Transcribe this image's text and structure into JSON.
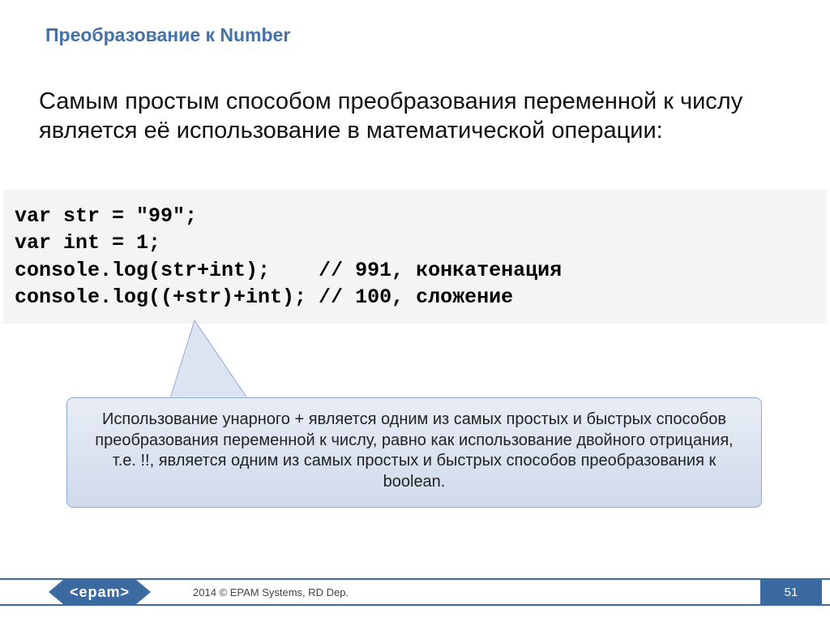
{
  "title": "Преобразование к Number",
  "body": "Самым простым способом преобразования переменной к числу является её использование в математической операции:",
  "code": {
    "l1": "var str = \"99\";",
    "l2": "var int = 1;",
    "l3": "console.log(str+int);    // 991, конкатенация",
    "l4": "console.log((+str)+int); // 100, сложение"
  },
  "callout": "Использование унарного + является одним из самых простых и быстрых способов преобразования переменной к числу, равно как использование двойного отрицания, т.е. !!, является одним из самых простых и быстрых способов преобразования к boolean.",
  "footer": {
    "logo": "<epam>",
    "copyright": "2014 © EPAM Systems, RD Dep.",
    "page": "51"
  }
}
